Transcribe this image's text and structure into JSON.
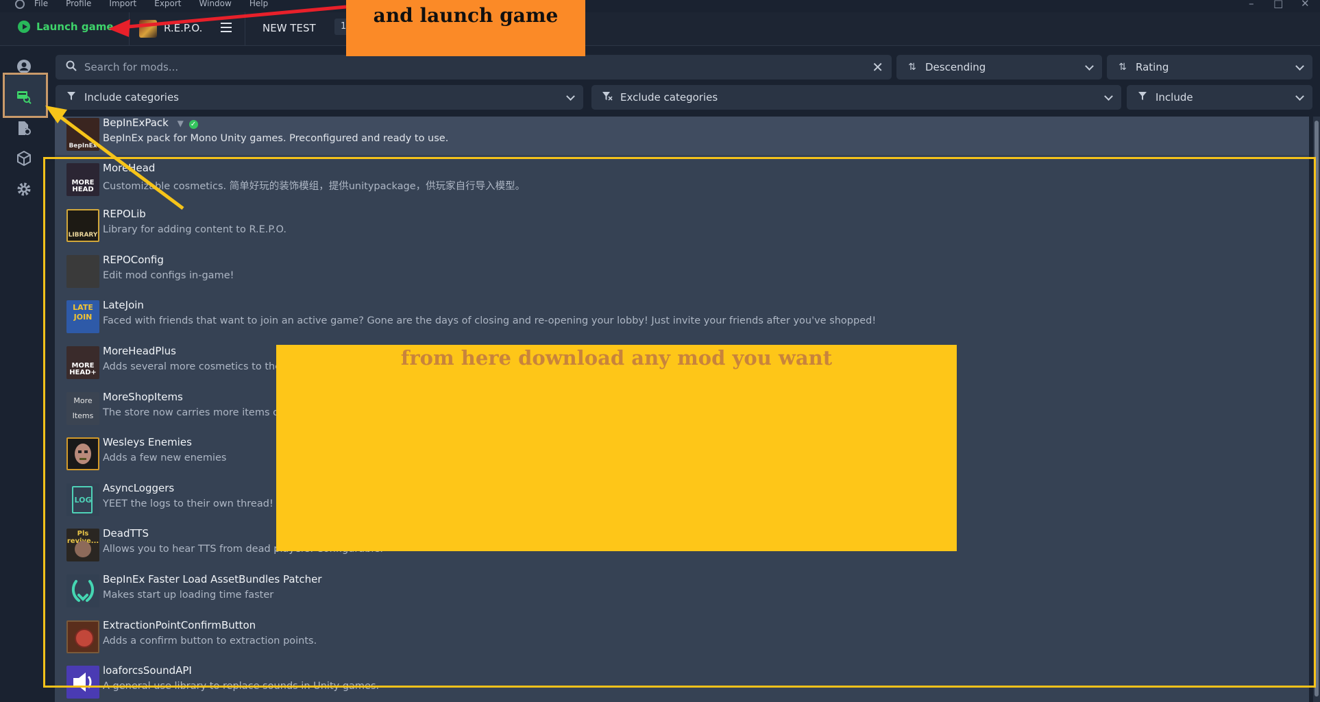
{
  "menubar": {
    "items": [
      "File",
      "Profile",
      "Import",
      "Export",
      "Window",
      "Help"
    ]
  },
  "topbar": {
    "launch_label": "Launch game",
    "game_name": "R.E.P.O.",
    "profile_name": "NEW TEST",
    "profile_count": "1"
  },
  "filters": {
    "search_placeholder": "Search for mods...",
    "sort_order": "Descending",
    "sort_by": "Rating",
    "include_categories": "Include categories",
    "exclude_categories": "Exclude categories",
    "include_mode": "Include"
  },
  "mods": [
    {
      "name": "BepInExPack",
      "desc": "BepInEx pack for Mono Unity games. Preconfigured and ready to use.",
      "thumb": "BepInEx"
    },
    {
      "name": "MoreHead",
      "desc": "Customizable cosmetics. 简单好玩的装饰模组，提供unitypackage，供玩家自行导入模型。",
      "thumb": "MORE HEAD"
    },
    {
      "name": "REPOLib",
      "desc": "Library for adding content to R.E.P.O.",
      "thumb": "LIBRARY"
    },
    {
      "name": "REPOConfig",
      "desc": "Edit mod configs in-game!",
      "thumb": ""
    },
    {
      "name": "LateJoin",
      "desc": "Faced with friends that want to join an active game? Gone are the days of closing and re-opening your lobby! Just invite your friends after you've shopped!",
      "thumb": "LATE JOIN"
    },
    {
      "name": "MoreHeadPlus",
      "desc": "Adds several more cosmetics to the",
      "thumb": "MORE HEAD+"
    },
    {
      "name": "MoreShopItems",
      "desc": "The store now carries more items o",
      "thumb": "More Items"
    },
    {
      "name": "Wesleys Enemies",
      "desc": "Adds a few new enemies",
      "thumb": ""
    },
    {
      "name": "AsyncLoggers",
      "desc": "YEET the logs to their own thread!",
      "thumb": "LOG"
    },
    {
      "name": "DeadTTS",
      "desc": "Allows you to hear TTS from dead players. Configurable.",
      "thumb": "Pls revive..."
    },
    {
      "name": "BepInEx Faster Load AssetBundles Patcher",
      "desc": "Makes start up loading time faster",
      "thumb": ""
    },
    {
      "name": "ExtractionPointConfirmButton",
      "desc": "Adds a confirm button to extraction points.",
      "thumb": ""
    },
    {
      "name": "loaforcsSoundAPI",
      "desc": "A general use library to replace sounds in Unity games.",
      "thumb": ""
    }
  ],
  "annotations": {
    "top_note": "and launch game",
    "middle_note": "from here download any mod you want"
  },
  "colors": {
    "accent_green": "#3ed36a",
    "note_orange": "#fb8a27",
    "note_yellow": "#fec618",
    "arrow_red": "#e8202a",
    "arrow_yellow": "#f6c419"
  }
}
